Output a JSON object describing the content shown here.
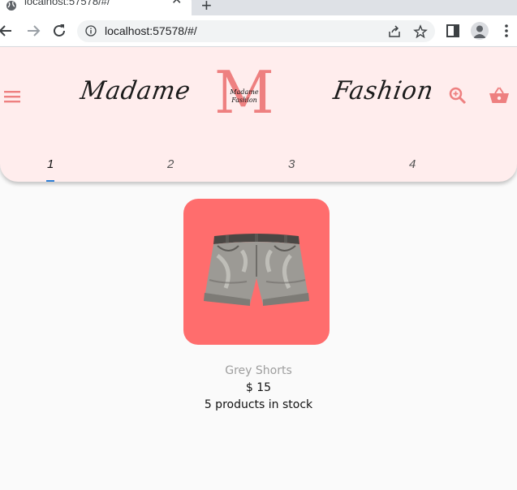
{
  "browser": {
    "tab_title": "localhost:57578/#/",
    "close_glyph": "✕",
    "new_tab_glyph": "+",
    "url": "localhost:57578/#/"
  },
  "header": {
    "brand_left": "Madame",
    "brand_right": "Fashion",
    "logo_letter": "M",
    "logo_signature": "Madame Fashion",
    "accent_color": "#ee8080",
    "background_color": "#ffeded",
    "icons": [
      "menu-icon",
      "search-icon",
      "basket-icon"
    ]
  },
  "tabs": [
    {
      "label": "1",
      "active": true
    },
    {
      "label": "2",
      "active": false
    },
    {
      "label": "3",
      "active": false
    },
    {
      "label": "4",
      "active": false
    }
  ],
  "product": {
    "name": "Grey Shorts",
    "price": "$ 15",
    "stock": "5 products in stock",
    "card_color": "#ff6d6d"
  }
}
